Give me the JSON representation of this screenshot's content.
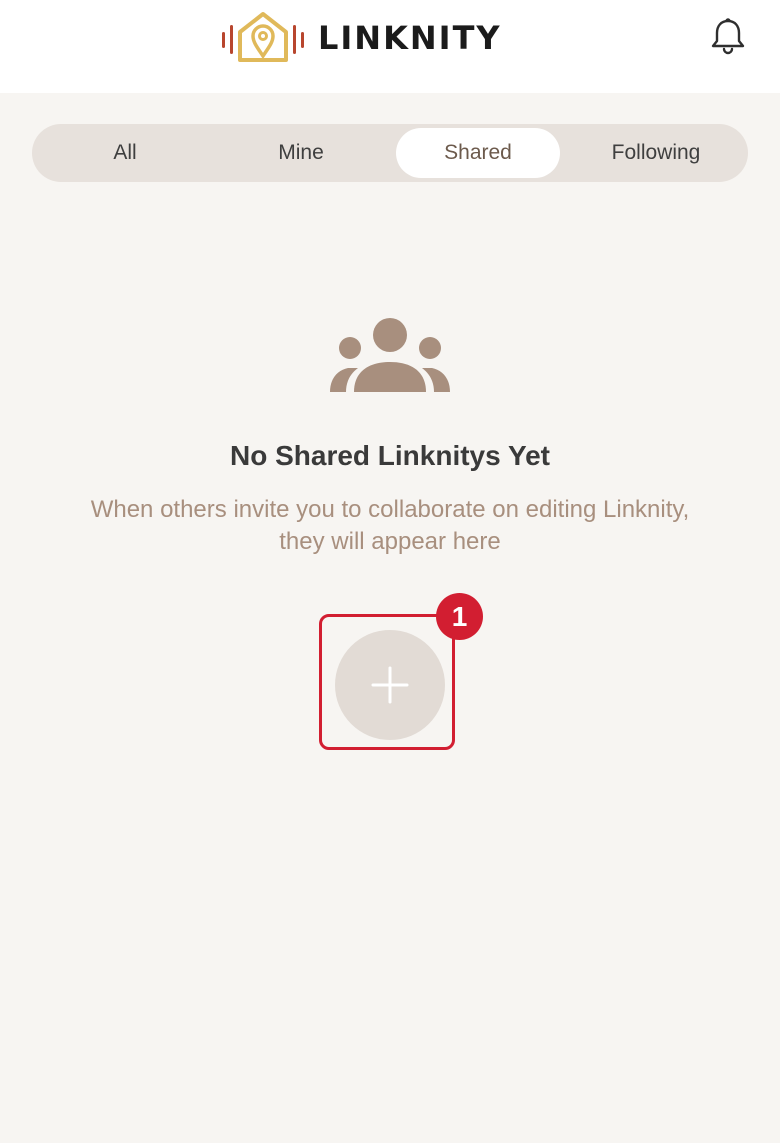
{
  "app": {
    "name": "LINKNITY",
    "logo_icon": "home-location-sound-logo",
    "notification_icon": "bell-icon"
  },
  "tabs": [
    {
      "label": "All",
      "active": false
    },
    {
      "label": "Mine",
      "active": false
    },
    {
      "label": "Shared",
      "active": true
    },
    {
      "label": "Following",
      "active": false
    }
  ],
  "empty_state": {
    "icon": "people-group-icon",
    "title": "No Shared Linknitys Yet",
    "description": "When others invite you to collaborate on editing Linknity, they will appear here"
  },
  "add_button": {
    "icon": "plus-icon",
    "badge": "1"
  },
  "colors": {
    "background": "#f7f5f2",
    "tab_bar": "#e7e1dc",
    "accent_brown": "#a88f7e",
    "logo_gold": "#e0b95a",
    "logo_red": "#b8462e",
    "highlight_red": "#d21e31"
  }
}
